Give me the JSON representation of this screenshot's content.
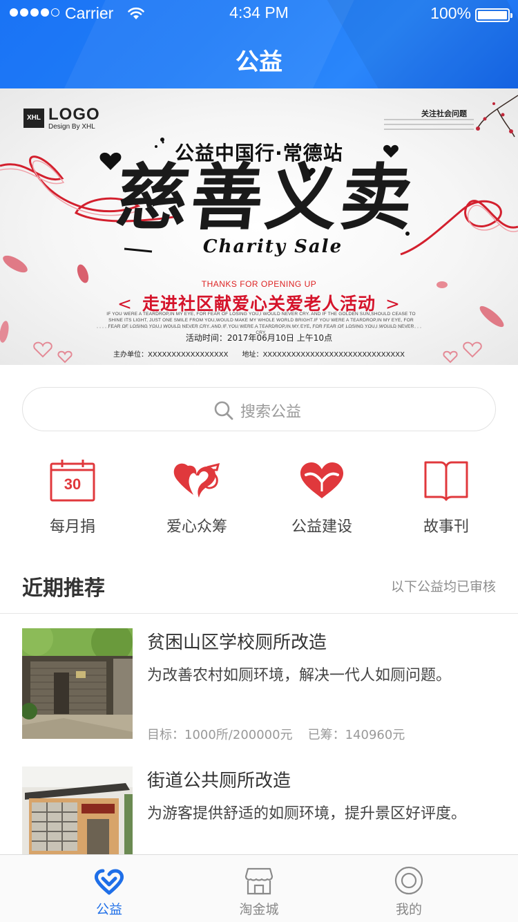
{
  "status_bar": {
    "carrier": "Carrier",
    "time": "4:34 PM",
    "battery": "100%"
  },
  "header": {
    "title": "公益"
  },
  "banner": {
    "logo_mark": "XHL",
    "logo_text": "LOGO",
    "logo_sub": "Design By XHL",
    "top_right": "关注社会问题",
    "subtitle": "公益中国行·常德站",
    "calligraphy": "慈善义卖",
    "english": "Charity Sale",
    "thanks": "THANKS FOR OPENING UP",
    "slogan": "走进社区献爱心关爱老人活动",
    "fine_print": "IF YOU WERE A TEARDROP,IN MY EYE, FOR FEAR OF LOSING YOU,I WOULD NEVER CRY. AND IF THE GOLDEN SUN,SHOULD CEASE TO SHINE ITS LIGHT, JUST ONE SMILE FROM YOU,WOULD MAKE MY WHOLE WORLD BRIGHT.IF YOU WERE A TEARDROP,IN MY EYE, FOR FEAR OF LOSING YOU,I WOULD NEVER CRY. AND IF YOU WERE A TEARDROP,IN MY EYE, FOR FEAR OF LOSING YOU,I WOULD NEVER CRY.",
    "date": "活动时间：2017年06月10日 上午10点",
    "host": "主办单位：XXXXXXXXXXXXXXXXX　　地址：XXXXXXXXXXXXXXXXXXXXXXXXXXXXXX"
  },
  "search": {
    "placeholder": "搜索公益"
  },
  "categories": [
    {
      "label": "每月捐",
      "icon": "calendar-30-icon",
      "day": "30"
    },
    {
      "label": "爱心众筹",
      "icon": "love-crowdfund-icon"
    },
    {
      "label": "公益建设",
      "icon": "heart-hands-icon"
    },
    {
      "label": "故事刊",
      "icon": "book-icon"
    }
  ],
  "section": {
    "title": "近期推荐",
    "note": "以下公益均已审核"
  },
  "items": [
    {
      "title": "贫困山区学校厕所改造",
      "desc": "为改善农村如厕环境，解决一代人如厕问题。",
      "target": "目标：1000所/200000元",
      "raised": "已筹：140960元"
    },
    {
      "title": "街道公共厕所改造",
      "desc": "为游客提供舒适的如厕环境，提升景区好评度。"
    }
  ],
  "tabbar": [
    {
      "label": "公益",
      "icon": "charity-heart-icon",
      "active": true
    },
    {
      "label": "淘金城",
      "icon": "shop-icon",
      "active": false
    },
    {
      "label": "我的",
      "icon": "profile-circle-icon",
      "active": false
    }
  ],
  "colors": {
    "primary": "#1f6fe8",
    "header": "#1a73f5",
    "accent_red": "#e0383c"
  }
}
